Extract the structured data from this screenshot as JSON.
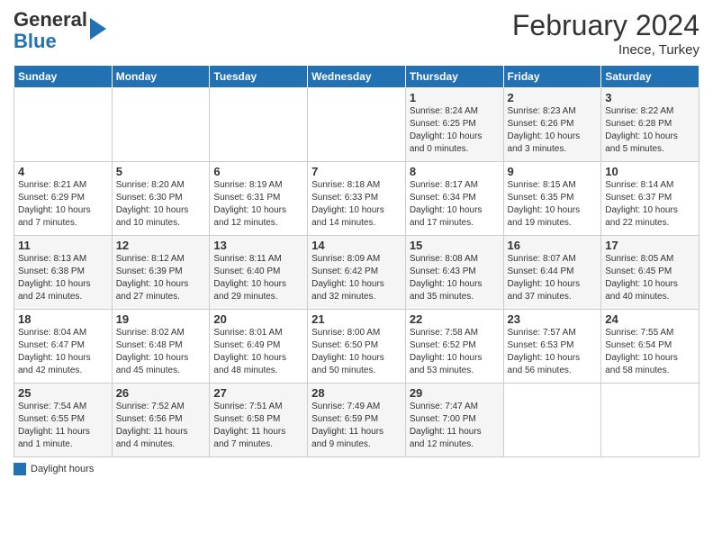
{
  "header": {
    "logo_line1": "General",
    "logo_line2": "Blue",
    "month_title": "February 2024",
    "location": "Inece, Turkey"
  },
  "days_of_week": [
    "Sunday",
    "Monday",
    "Tuesday",
    "Wednesday",
    "Thursday",
    "Friday",
    "Saturday"
  ],
  "footer": {
    "legend_label": "Daylight hours"
  },
  "weeks": [
    {
      "days": [
        {
          "num": "",
          "info": ""
        },
        {
          "num": "",
          "info": ""
        },
        {
          "num": "",
          "info": ""
        },
        {
          "num": "",
          "info": ""
        },
        {
          "num": "1",
          "info": "Sunrise: 8:24 AM\nSunset: 6:25 PM\nDaylight: 10 hours\nand 0 minutes."
        },
        {
          "num": "2",
          "info": "Sunrise: 8:23 AM\nSunset: 6:26 PM\nDaylight: 10 hours\nand 3 minutes."
        },
        {
          "num": "3",
          "info": "Sunrise: 8:22 AM\nSunset: 6:28 PM\nDaylight: 10 hours\nand 5 minutes."
        }
      ]
    },
    {
      "days": [
        {
          "num": "4",
          "info": "Sunrise: 8:21 AM\nSunset: 6:29 PM\nDaylight: 10 hours\nand 7 minutes."
        },
        {
          "num": "5",
          "info": "Sunrise: 8:20 AM\nSunset: 6:30 PM\nDaylight: 10 hours\nand 10 minutes."
        },
        {
          "num": "6",
          "info": "Sunrise: 8:19 AM\nSunset: 6:31 PM\nDaylight: 10 hours\nand 12 minutes."
        },
        {
          "num": "7",
          "info": "Sunrise: 8:18 AM\nSunset: 6:33 PM\nDaylight: 10 hours\nand 14 minutes."
        },
        {
          "num": "8",
          "info": "Sunrise: 8:17 AM\nSunset: 6:34 PM\nDaylight: 10 hours\nand 17 minutes."
        },
        {
          "num": "9",
          "info": "Sunrise: 8:15 AM\nSunset: 6:35 PM\nDaylight: 10 hours\nand 19 minutes."
        },
        {
          "num": "10",
          "info": "Sunrise: 8:14 AM\nSunset: 6:37 PM\nDaylight: 10 hours\nand 22 minutes."
        }
      ]
    },
    {
      "days": [
        {
          "num": "11",
          "info": "Sunrise: 8:13 AM\nSunset: 6:38 PM\nDaylight: 10 hours\nand 24 minutes."
        },
        {
          "num": "12",
          "info": "Sunrise: 8:12 AM\nSunset: 6:39 PM\nDaylight: 10 hours\nand 27 minutes."
        },
        {
          "num": "13",
          "info": "Sunrise: 8:11 AM\nSunset: 6:40 PM\nDaylight: 10 hours\nand 29 minutes."
        },
        {
          "num": "14",
          "info": "Sunrise: 8:09 AM\nSunset: 6:42 PM\nDaylight: 10 hours\nand 32 minutes."
        },
        {
          "num": "15",
          "info": "Sunrise: 8:08 AM\nSunset: 6:43 PM\nDaylight: 10 hours\nand 35 minutes."
        },
        {
          "num": "16",
          "info": "Sunrise: 8:07 AM\nSunset: 6:44 PM\nDaylight: 10 hours\nand 37 minutes."
        },
        {
          "num": "17",
          "info": "Sunrise: 8:05 AM\nSunset: 6:45 PM\nDaylight: 10 hours\nand 40 minutes."
        }
      ]
    },
    {
      "days": [
        {
          "num": "18",
          "info": "Sunrise: 8:04 AM\nSunset: 6:47 PM\nDaylight: 10 hours\nand 42 minutes."
        },
        {
          "num": "19",
          "info": "Sunrise: 8:02 AM\nSunset: 6:48 PM\nDaylight: 10 hours\nand 45 minutes."
        },
        {
          "num": "20",
          "info": "Sunrise: 8:01 AM\nSunset: 6:49 PM\nDaylight: 10 hours\nand 48 minutes."
        },
        {
          "num": "21",
          "info": "Sunrise: 8:00 AM\nSunset: 6:50 PM\nDaylight: 10 hours\nand 50 minutes."
        },
        {
          "num": "22",
          "info": "Sunrise: 7:58 AM\nSunset: 6:52 PM\nDaylight: 10 hours\nand 53 minutes."
        },
        {
          "num": "23",
          "info": "Sunrise: 7:57 AM\nSunset: 6:53 PM\nDaylight: 10 hours\nand 56 minutes."
        },
        {
          "num": "24",
          "info": "Sunrise: 7:55 AM\nSunset: 6:54 PM\nDaylight: 10 hours\nand 58 minutes."
        }
      ]
    },
    {
      "days": [
        {
          "num": "25",
          "info": "Sunrise: 7:54 AM\nSunset: 6:55 PM\nDaylight: 11 hours\nand 1 minute."
        },
        {
          "num": "26",
          "info": "Sunrise: 7:52 AM\nSunset: 6:56 PM\nDaylight: 11 hours\nand 4 minutes."
        },
        {
          "num": "27",
          "info": "Sunrise: 7:51 AM\nSunset: 6:58 PM\nDaylight: 11 hours\nand 7 minutes."
        },
        {
          "num": "28",
          "info": "Sunrise: 7:49 AM\nSunset: 6:59 PM\nDaylight: 11 hours\nand 9 minutes."
        },
        {
          "num": "29",
          "info": "Sunrise: 7:47 AM\nSunset: 7:00 PM\nDaylight: 11 hours\nand 12 minutes."
        },
        {
          "num": "",
          "info": ""
        },
        {
          "num": "",
          "info": ""
        }
      ]
    }
  ]
}
